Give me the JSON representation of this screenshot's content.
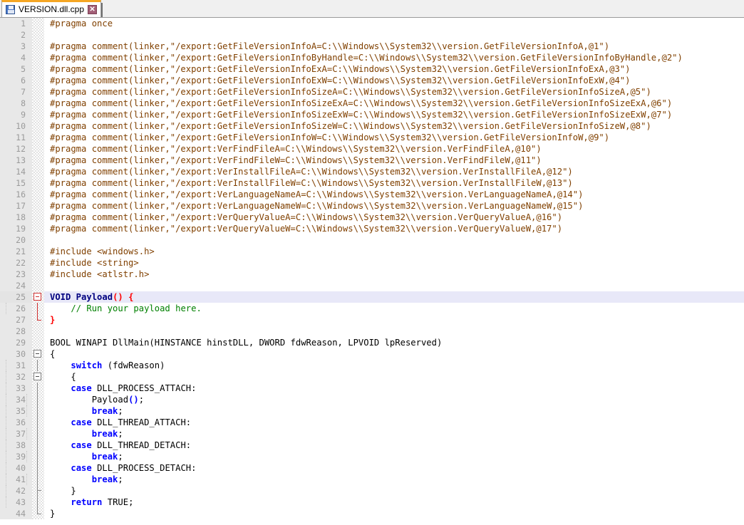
{
  "window": {
    "title": "VERSION.dll.cpp",
    "editor_name": "notepad-plus-plus-editor"
  },
  "tab": {
    "label": "VERSION.dll.cpp",
    "save_icon": "save-icon",
    "close_icon": "close-icon",
    "close_glyph": "✕",
    "modified": false
  },
  "colors": {
    "tab_accent": "#f5a623",
    "preprocessor": "#804000",
    "keyword": "#0000ff",
    "type": "#000080",
    "comment": "#008000",
    "brace_match": "#ff0000",
    "gutter_bg": "#e8e8e8",
    "gutter_fg": "#9a9a9a",
    "current_line_bg": "#e8e8f8",
    "editor_bg": "#ffffff"
  },
  "editor": {
    "current_line": 25,
    "first_line": 1,
    "last_line": 44,
    "language": "C++",
    "lines": [
      {
        "n": 1,
        "fold": "none",
        "text": "#pragma once",
        "type": "pre"
      },
      {
        "n": 2,
        "fold": "none",
        "text": "",
        "type": "blank"
      },
      {
        "n": 3,
        "fold": "none",
        "text": "#pragma comment(linker,\"/export:GetFileVersionInfoA=C:\\\\Windows\\\\System32\\\\version.GetFileVersionInfoA,@1\")",
        "type": "pre"
      },
      {
        "n": 4,
        "fold": "none",
        "text": "#pragma comment(linker,\"/export:GetFileVersionInfoByHandle=C:\\\\Windows\\\\System32\\\\version.GetFileVersionInfoByHandle,@2\")",
        "type": "pre"
      },
      {
        "n": 5,
        "fold": "none",
        "text": "#pragma comment(linker,\"/export:GetFileVersionInfoExA=C:\\\\Windows\\\\System32\\\\version.GetFileVersionInfoExA,@3\")",
        "type": "pre"
      },
      {
        "n": 6,
        "fold": "none",
        "text": "#pragma comment(linker,\"/export:GetFileVersionInfoExW=C:\\\\Windows\\\\System32\\\\version.GetFileVersionInfoExW,@4\")",
        "type": "pre"
      },
      {
        "n": 7,
        "fold": "none",
        "text": "#pragma comment(linker,\"/export:GetFileVersionInfoSizeA=C:\\\\Windows\\\\System32\\\\version.GetFileVersionInfoSizeA,@5\")",
        "type": "pre"
      },
      {
        "n": 8,
        "fold": "none",
        "text": "#pragma comment(linker,\"/export:GetFileVersionInfoSizeExA=C:\\\\Windows\\\\System32\\\\version.GetFileVersionInfoSizeExA,@6\")",
        "type": "pre"
      },
      {
        "n": 9,
        "fold": "none",
        "text": "#pragma comment(linker,\"/export:GetFileVersionInfoSizeExW=C:\\\\Windows\\\\System32\\\\version.GetFileVersionInfoSizeExW,@7\")",
        "type": "pre"
      },
      {
        "n": 10,
        "fold": "none",
        "text": "#pragma comment(linker,\"/export:GetFileVersionInfoSizeW=C:\\\\Windows\\\\System32\\\\version.GetFileVersionInfoSizeW,@8\")",
        "type": "pre"
      },
      {
        "n": 11,
        "fold": "none",
        "text": "#pragma comment(linker,\"/export:GetFileVersionInfoW=C:\\\\Windows\\\\System32\\\\version.GetFileVersionInfoW,@9\")",
        "type": "pre"
      },
      {
        "n": 12,
        "fold": "none",
        "text": "#pragma comment(linker,\"/export:VerFindFileA=C:\\\\Windows\\\\System32\\\\version.VerFindFileA,@10\")",
        "type": "pre"
      },
      {
        "n": 13,
        "fold": "none",
        "text": "#pragma comment(linker,\"/export:VerFindFileW=C:\\\\Windows\\\\System32\\\\version.VerFindFileW,@11\")",
        "type": "pre"
      },
      {
        "n": 14,
        "fold": "none",
        "text": "#pragma comment(linker,\"/export:VerInstallFileA=C:\\\\Windows\\\\System32\\\\version.VerInstallFileA,@12\")",
        "type": "pre"
      },
      {
        "n": 15,
        "fold": "none",
        "text": "#pragma comment(linker,\"/export:VerInstallFileW=C:\\\\Windows\\\\System32\\\\version.VerInstallFileW,@13\")",
        "type": "pre"
      },
      {
        "n": 16,
        "fold": "none",
        "text": "#pragma comment(linker,\"/export:VerLanguageNameA=C:\\\\Windows\\\\System32\\\\version.VerLanguageNameA,@14\")",
        "type": "pre"
      },
      {
        "n": 17,
        "fold": "none",
        "text": "#pragma comment(linker,\"/export:VerLanguageNameW=C:\\\\Windows\\\\System32\\\\version.VerLanguageNameW,@15\")",
        "type": "pre"
      },
      {
        "n": 18,
        "fold": "none",
        "text": "#pragma comment(linker,\"/export:VerQueryValueA=C:\\\\Windows\\\\System32\\\\version.VerQueryValueA,@16\")",
        "type": "pre"
      },
      {
        "n": 19,
        "fold": "none",
        "text": "#pragma comment(linker,\"/export:VerQueryValueW=C:\\\\Windows\\\\System32\\\\version.VerQueryValueW,@17\")",
        "type": "pre"
      },
      {
        "n": 20,
        "fold": "none",
        "text": "",
        "type": "blank"
      },
      {
        "n": 21,
        "fold": "none",
        "text": "#include <windows.h>",
        "type": "pre"
      },
      {
        "n": 22,
        "fold": "none",
        "text": "#include <string>",
        "type": "pre"
      },
      {
        "n": 23,
        "fold": "none",
        "text": "#include <atlstr.h>",
        "type": "pre"
      },
      {
        "n": 24,
        "fold": "none",
        "text": "",
        "type": "blank"
      },
      {
        "n": 25,
        "fold": "box-red",
        "text": "VOID Payload() {",
        "type": "func-open"
      },
      {
        "n": 26,
        "fold": "line-red",
        "text": "    // Run your payload here.",
        "type": "comment"
      },
      {
        "n": 27,
        "fold": "end-red",
        "text": "}",
        "type": "close-brace-red"
      },
      {
        "n": 28,
        "fold": "none",
        "text": "",
        "type": "blank"
      },
      {
        "n": 29,
        "fold": "none",
        "text": "BOOL WINAPI DllMain(HINSTANCE hinstDLL, DWORD fdwReason, LPVOID lpReserved)",
        "type": "signature"
      },
      {
        "n": 30,
        "fold": "box",
        "text": "{",
        "type": "open-brace"
      },
      {
        "n": 31,
        "fold": "line",
        "text": "    switch (fdwReason)",
        "type": "switch"
      },
      {
        "n": 32,
        "fold": "box2",
        "text": "    {",
        "type": "open-brace"
      },
      {
        "n": 33,
        "fold": "line",
        "text": "    case DLL_PROCESS_ATTACH:",
        "type": "case"
      },
      {
        "n": 34,
        "fold": "line",
        "text": "        Payload();",
        "type": "call"
      },
      {
        "n": 35,
        "fold": "line",
        "text": "        break;",
        "type": "break"
      },
      {
        "n": 36,
        "fold": "line",
        "text": "    case DLL_THREAD_ATTACH:",
        "type": "case"
      },
      {
        "n": 37,
        "fold": "line",
        "text": "        break;",
        "type": "break"
      },
      {
        "n": 38,
        "fold": "line",
        "text": "    case DLL_THREAD_DETACH:",
        "type": "case"
      },
      {
        "n": 39,
        "fold": "line",
        "text": "        break;",
        "type": "break"
      },
      {
        "n": 40,
        "fold": "line",
        "text": "    case DLL_PROCESS_DETACH:",
        "type": "case"
      },
      {
        "n": 41,
        "fold": "line",
        "text": "        break;",
        "type": "break"
      },
      {
        "n": 42,
        "fold": "tick",
        "text": "    }",
        "type": "close-brace"
      },
      {
        "n": 43,
        "fold": "line",
        "text": "    return TRUE;",
        "type": "return"
      },
      {
        "n": 44,
        "fold": "end",
        "text": "}",
        "type": "close-brace"
      }
    ]
  }
}
